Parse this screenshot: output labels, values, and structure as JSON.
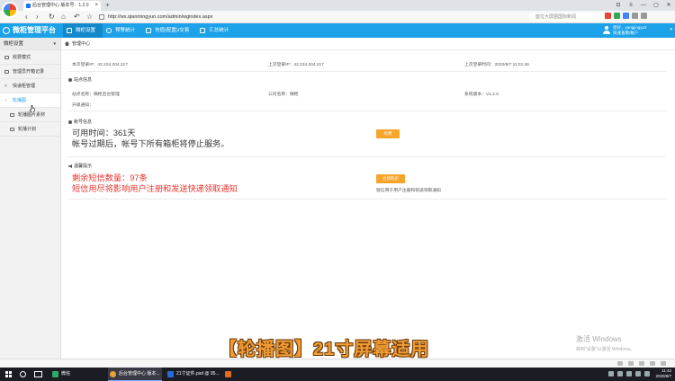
{
  "browser": {
    "tab_title": "后台管理中心 版本号：1.2.0",
    "tab_close": "×",
    "new_tab": "+",
    "url": "http://wx.qianmingyun.com/admin/wgindex.aspx",
    "search_hint": "座位大屏图国际新闻",
    "nav_back": "‹",
    "nav_forward": "›",
    "nav_reload": "↻",
    "nav_home": "⌂",
    "nav_undo": "↶",
    "nav_star": "☆",
    "win_controls": [
      "⊡",
      "≡",
      "—",
      "▢",
      "✕"
    ]
  },
  "header": {
    "brand": "微柜管理平台",
    "nav": [
      {
        "label": "微柜设置"
      },
      {
        "label": "预警统计"
      },
      {
        "label": "充值(配置)/交易"
      },
      {
        "label": "汇总统计"
      }
    ],
    "user_line1": "您好，yangjingyu2",
    "user_line2": "快速查看/账户",
    "user_chevron": "▾"
  },
  "sidebar": {
    "title": "微柜设置",
    "title_chevron": "▾",
    "items": [
      {
        "label": "收费模式"
      },
      {
        "label": "管理员开箱记录"
      },
      {
        "label": "快递柜管理",
        "marker": "+"
      },
      {
        "label": "轮播图",
        "marker": "−"
      },
      {
        "label": "轮播图片素材"
      },
      {
        "label": "轮播计划"
      }
    ]
  },
  "main": {
    "breadcrumb": "管理中心",
    "login": {
      "this_ip": "本次登录IP：42.224.204.217",
      "last_ip": "上次登录IP：42.224.204.217",
      "last_time": "上次登录时间：2020/8/7 11:01:46"
    },
    "site_info": {
      "title": "站点信息",
      "site_name": "站点名称：微柜后台管理",
      "company": "公司名称：微柜",
      "version": "系统版本：V1.2.0",
      "upgrade": "升级通知："
    },
    "account": {
      "title": "帐号信息",
      "available": "可用时间：361天",
      "expire_note": "帐号过期后，帐号下所有箱柜将停止服务。",
      "button": "续费"
    },
    "warning": {
      "title": "温馨提示",
      "sms_remaining": "剩余短信数量：97条",
      "sms_note": "短信用尽将影响用户注册和发送快递领取通知",
      "button": "立即购买",
      "button_note": "短信用于用户注册和快递领取通知"
    }
  },
  "overlay": {
    "caption": "【轮播图】21寸屏幕适用"
  },
  "watermark": {
    "line1": "激活 Windows",
    "line2": "转到\"设置\"以激活 Windows。"
  },
  "taskbar": {
    "apps": [
      {
        "label": "微信",
        "color": "#2aae67"
      },
      {
        "label": "后台管理中心 版本...",
        "color": "#e9a23b"
      },
      {
        "label": "21寸证件.psd @ 95...",
        "color": "#2a6ad9"
      },
      {
        "label": "",
        "color": "#e36b1d"
      }
    ],
    "time": "11:42",
    "date": "2020/8/7"
  },
  "colors": {
    "header_blue": "#1da1e8",
    "alert_red": "#e8332c",
    "button_orange": "#f7a42b"
  }
}
